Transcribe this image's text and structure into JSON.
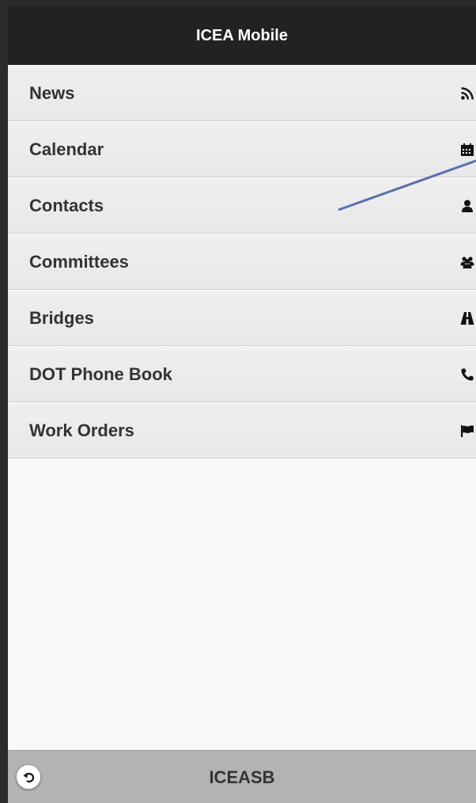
{
  "header": {
    "title": "ICEA Mobile"
  },
  "menu": {
    "items": [
      {
        "label": "News",
        "icon": "rss-icon"
      },
      {
        "label": "Calendar",
        "icon": "calendar-icon"
      },
      {
        "label": "Contacts",
        "icon": "user-icon"
      },
      {
        "label": "Committees",
        "icon": "group-icon"
      },
      {
        "label": "Bridges",
        "icon": "road-icon"
      },
      {
        "label": "DOT Phone Book",
        "icon": "phone-icon"
      },
      {
        "label": "Work Orders",
        "icon": "flag-icon"
      }
    ]
  },
  "footer": {
    "title": "ICEASB",
    "back_icon": "back-icon"
  },
  "colors": {
    "header_bg": "#222222",
    "menu_bg": "#ececec",
    "footer_bg": "#b3b3b3",
    "text": "#333333",
    "annotation": "#5b6fae"
  }
}
